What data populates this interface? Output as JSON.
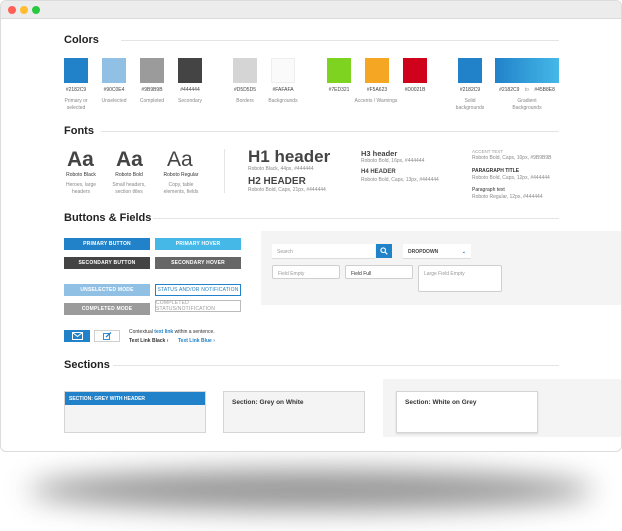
{
  "sections": {
    "colors": "Colors",
    "fonts": "Fonts",
    "buttons": "Buttons & Fields",
    "sections": "Sections"
  },
  "colors": {
    "swatches": [
      {
        "hex": "#2182C9",
        "caption": "Primary or selected"
      },
      {
        "hex": "#90C0E4",
        "caption": "Unselected"
      },
      {
        "hex": "#9B9B9B",
        "caption": "Completed"
      },
      {
        "hex": "#444444",
        "caption": "Secondary"
      },
      {
        "hex": "#D5D5D5",
        "caption": "Borders"
      },
      {
        "hex": "#FAFAFA",
        "caption": "Backgrounds"
      },
      {
        "hex": "#7ED321",
        "caption": ""
      },
      {
        "hex": "#F5A623",
        "caption": "Accents / Warnings"
      },
      {
        "hex": "#D0021B",
        "caption": ""
      },
      {
        "hex": "#2182C9",
        "caption": "Solid backgrounds"
      }
    ],
    "gradient": {
      "from": "#2182C9",
      "to": "#45B8E8",
      "caption": "Gradient Backgrounds",
      "to_word": "to"
    }
  },
  "fonts": {
    "samples": [
      {
        "glyph": "Aa",
        "name": "Roboto Black",
        "use": "Heroes, large headers"
      },
      {
        "glyph": "Aa",
        "name": "Roboto Bold",
        "use": "Small headers, section titles"
      },
      {
        "glyph": "Aa",
        "name": "Roboto Regular",
        "use": "Copy, table elements, fields"
      }
    ],
    "h1": {
      "title": "H1 header",
      "spec": "Roboto Black, 44px, #444444"
    },
    "h2": {
      "title": "H2 HEADER",
      "spec": "Roboto Bold, Caps, 21px, #444444"
    },
    "h3": {
      "title": "H3 header",
      "spec": "Roboto Bold, 16px, #444444"
    },
    "h4": {
      "title": "H4 HEADER",
      "spec": "Roboto Bold, Caps, 13px, #444444"
    },
    "accent": {
      "title": "ACCENT TEXT",
      "spec": "Roboto Bold, Caps, 10px, #9B9B9B"
    },
    "paragraph_title": {
      "title": "PARAGRAPH TITLE",
      "spec": "Roboto Bold, Caps, 12px, #444444"
    },
    "paragraph_text": {
      "title": "Paragraph text",
      "spec": "Roboto Regular, 12px, #444444"
    }
  },
  "buttons": {
    "primary": "PRIMARY BUTTON",
    "primary_hover": "PRIMARY HOVER",
    "secondary": "SECONDARY BUTTON",
    "secondary_hover": "SECONDARY HOVER",
    "unselected": "UNSELECTED MODE",
    "status": "STATUS AND/OR NOTIFICATION",
    "completed": "COMPLETED MODE",
    "completed_status": "COMPLETED STATUS/NOTIFICATION"
  },
  "fields": {
    "search_placeholder": "Search",
    "dropdown": "DROPDOWN",
    "field_empty": "Field Empty",
    "field_full": "Field Full",
    "large_field_empty": "Large Field Empty"
  },
  "links": {
    "sentence_pre": "Contextual ",
    "sentence_link": "text link",
    "sentence_post": " within a sentence.",
    "black": "Text Link Black",
    "blue": "Text Link Blue"
  },
  "section_samples": {
    "grey_header": "SECTION: GREY WITH HEADER",
    "grey_on_white": "Section: Grey on White",
    "white_on_grey": "Section: White on Grey"
  }
}
